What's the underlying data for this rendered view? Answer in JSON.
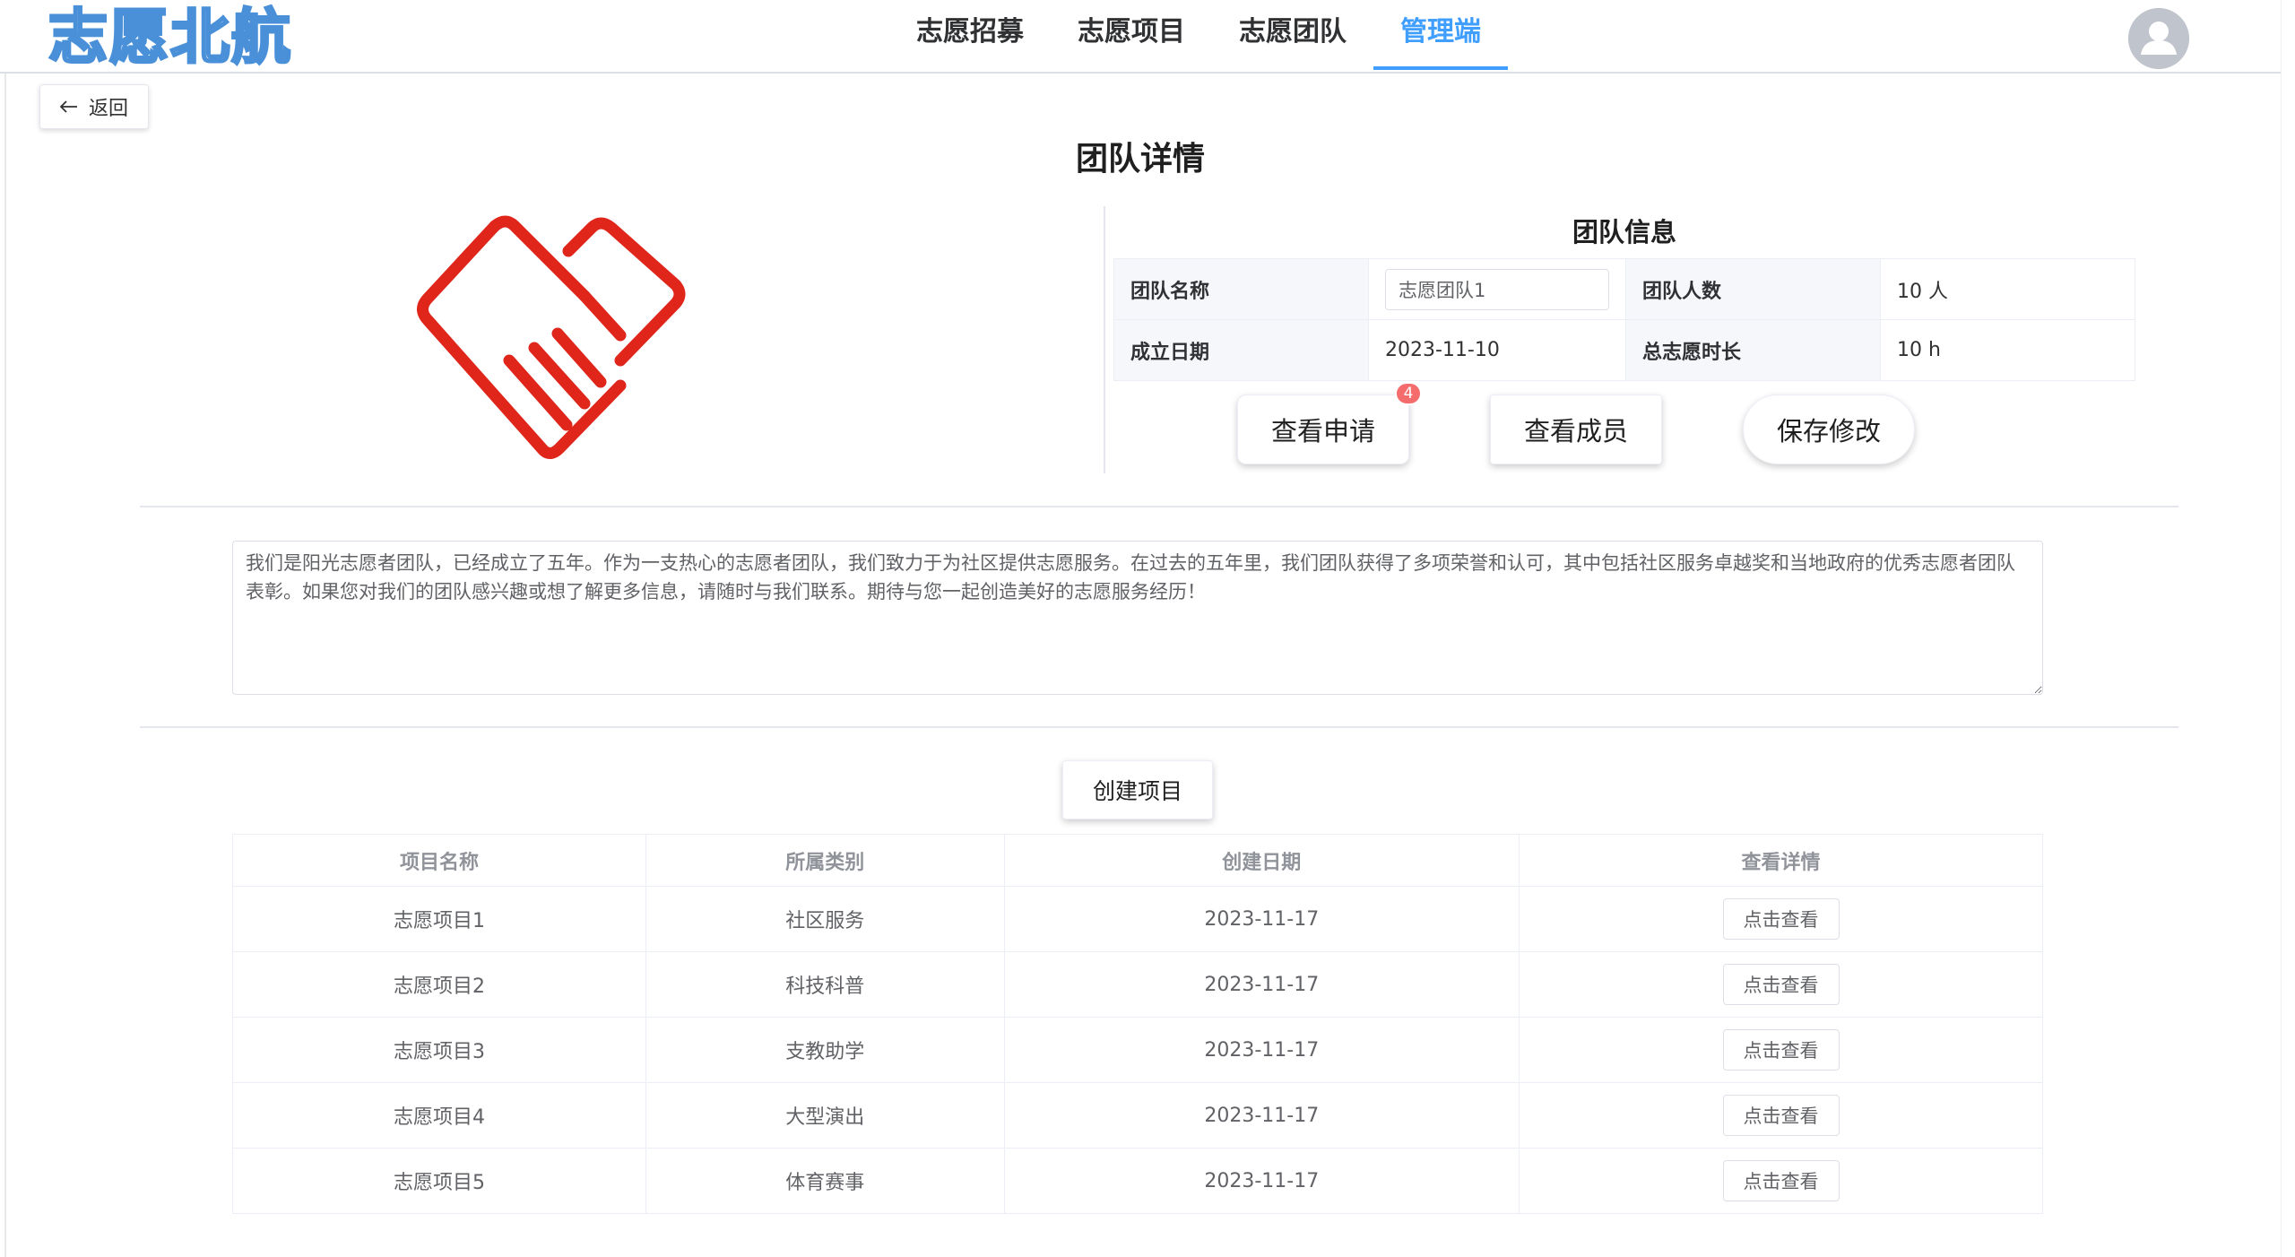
{
  "header": {
    "brand": "志愿北航",
    "nav": [
      {
        "label": "志愿招募"
      },
      {
        "label": "志愿项目"
      },
      {
        "label": "志愿团队"
      },
      {
        "label": "管理端"
      }
    ],
    "active_nav": "管理端",
    "avatar_icon": "user-avatar-icon"
  },
  "back": {
    "label": "返回",
    "icon": "arrow-left-icon"
  },
  "page_title": "团队详情",
  "logo_icon": "handshake-heart-icon",
  "logo_color": "#e0251b",
  "info": {
    "title": "团队信息",
    "name_label": "团队名称",
    "name_value": "志愿团队1",
    "members_label": "团队人数",
    "members_value": "10 人",
    "founded_label": "成立日期",
    "founded_value": "2023-11-10",
    "hours_label": "总志愿时长",
    "hours_value": "10 h"
  },
  "actions": {
    "view_applications": "查看申请",
    "applications_badge": "4",
    "view_members": "查看成员",
    "save_changes": "保存修改"
  },
  "description": "我们是阳光志愿者团队，已经成立了五年。作为一支热心的志愿者团队，我们致力于为社区提供志愿服务。在过去的五年里，我们团队获得了多项荣誉和认可，其中包括社区服务卓越奖和当地政府的优秀志愿者团队表彰。如果您对我们的团队感兴趣或想了解更多信息，请随时与我们联系。期待与您一起创造美好的志愿服务经历！",
  "create_project": "创建项目",
  "projects": {
    "columns": [
      "项目名称",
      "所属类别",
      "创建日期",
      "查看详情"
    ],
    "rows": [
      {
        "name": "志愿项目1",
        "category": "社区服务",
        "date": "2023-11-17",
        "action": "点击查看"
      },
      {
        "name": "志愿项目2",
        "category": "科技科普",
        "date": "2023-11-17",
        "action": "点击查看"
      },
      {
        "name": "志愿项目3",
        "category": "支教助学",
        "date": "2023-11-17",
        "action": "点击查看"
      },
      {
        "name": "志愿项目4",
        "category": "大型演出",
        "date": "2023-11-17",
        "action": "点击查看"
      },
      {
        "name": "志愿项目5",
        "category": "体育赛事",
        "date": "2023-11-17",
        "action": "点击查看"
      }
    ]
  }
}
